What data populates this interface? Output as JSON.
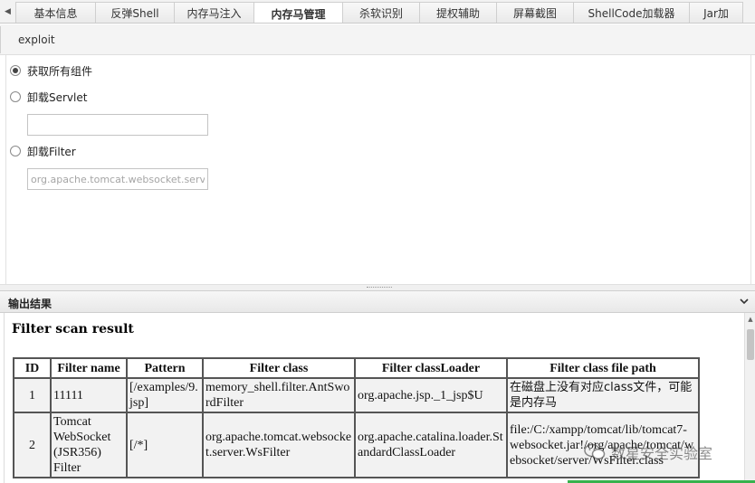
{
  "tabs": [
    {
      "label": "基本信息",
      "active": false
    },
    {
      "label": "反弹Shell",
      "active": false
    },
    {
      "label": "内存马注入",
      "active": false
    },
    {
      "label": "内存马管理",
      "active": true
    },
    {
      "label": "杀软识别",
      "active": false
    },
    {
      "label": "提权辅助",
      "active": false
    },
    {
      "label": "屏幕截图",
      "active": false
    },
    {
      "label": "ShellCode加载器",
      "active": false
    },
    {
      "label": "Jar加",
      "active": false
    }
  ],
  "toolbar": {
    "exploit_label": "exploit"
  },
  "form": {
    "options": [
      {
        "label": "获取所有组件",
        "selected": true
      },
      {
        "label": "卸载Servlet",
        "selected": false
      },
      {
        "label": "卸载Filter",
        "selected": false
      }
    ],
    "servlet_value": "",
    "filter_placeholder": "org.apache.tomcat.websocket.server"
  },
  "output": {
    "title": "输出结果",
    "heading": "Filter scan result",
    "columns": [
      "ID",
      "Filter name",
      "Pattern",
      "Filter class",
      "Filter classLoader",
      "Filter class file path"
    ],
    "rows": [
      {
        "id": "1",
        "name": "11111",
        "pattern": "[/examples/9.jsp]",
        "class": "memory_shell.filter.AntSwordFilter",
        "loader": "org.apache.jsp._1_jsp$U",
        "path": "在磁盘上没有对应class文件，可能是内存马"
      },
      {
        "id": "2",
        "name": "Tomcat WebSocket (JSR356) Filter",
        "pattern": "[/*]",
        "class": "org.apache.tomcat.websocket.server.WsFilter",
        "loader": "org.apache.catalina.loader.StandardClassLoader",
        "path": "file:/C:/xampp/tomcat/lib/tomcat7-websocket.jar!/org/apache/tomcat/websocket/server/WsFilter.class"
      }
    ]
  },
  "watermark": {
    "text": "数星安全实验室"
  },
  "colors": {
    "progress": "#37b24d",
    "tab_bg": "#f2f2f2",
    "table_border": "#555555"
  }
}
